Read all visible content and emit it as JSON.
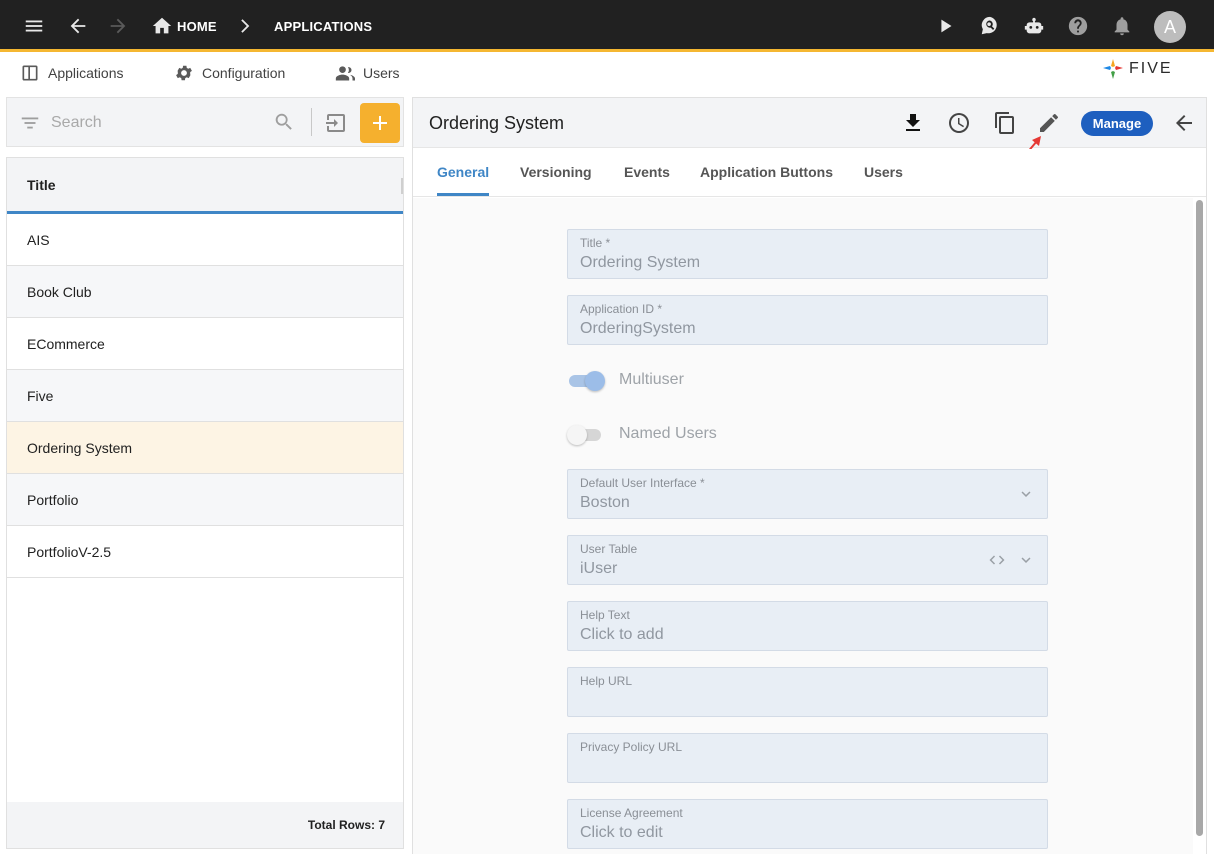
{
  "topbar": {
    "breadcrumbs": [
      "HOME",
      "APPLICATIONS"
    ],
    "avatar_initial": "A",
    "icons": [
      "menu-icon",
      "back-icon",
      "forward-icon",
      "home-icon",
      "chevron-right-icon",
      "play-icon",
      "search-chat-icon",
      "bot-icon",
      "help-icon",
      "bell-icon"
    ]
  },
  "subnav": {
    "items": [
      {
        "label": "Applications",
        "icon": "application-icon"
      },
      {
        "label": "Configuration",
        "icon": "configuration-gear-icon"
      },
      {
        "label": "Users",
        "icon": "users-icon"
      }
    ],
    "logo_text": "FIVE"
  },
  "left": {
    "search_placeholder": "Search",
    "column_header": "Title",
    "rows": [
      "AIS",
      "Book Club",
      "ECommerce",
      "Five",
      "Ordering System",
      "Portfolio",
      "PortfolioV-2.5"
    ],
    "selected_row": "Ordering System",
    "footer": "Total Rows: 7"
  },
  "form": {
    "title": "Ordering System",
    "manage_label": "Manage",
    "tabs": [
      "General",
      "Versioning",
      "Events",
      "Application Buttons",
      "Users"
    ],
    "active_tab": "General",
    "fields": {
      "title": {
        "label": "Title *",
        "value": "Ordering System"
      },
      "app_id": {
        "label": "Application ID *",
        "value": "OrderingSystem"
      },
      "multiuser": {
        "label": "Multiuser",
        "on": true
      },
      "named_users": {
        "label": "Named Users",
        "on": false
      },
      "default_ui": {
        "label": "Default User Interface *",
        "value": "Boston"
      },
      "user_table": {
        "label": "User Table",
        "value": "iUser"
      },
      "help_text": {
        "label": "Help Text",
        "value": "Click to add"
      },
      "help_url": {
        "label": "Help URL",
        "value": ""
      },
      "privacy_url": {
        "label": "Privacy Policy URL",
        "value": ""
      },
      "license": {
        "label": "License Agreement",
        "value": "Click to edit"
      }
    }
  },
  "colors": {
    "topbar_bg": "#212121",
    "accent_yellow": "#f5b02e",
    "accent_blue": "#3f86c6",
    "manage_button": "#1e5fbf",
    "selected_row": "#fdf4e4",
    "annotation_arrow": "#e53935"
  }
}
